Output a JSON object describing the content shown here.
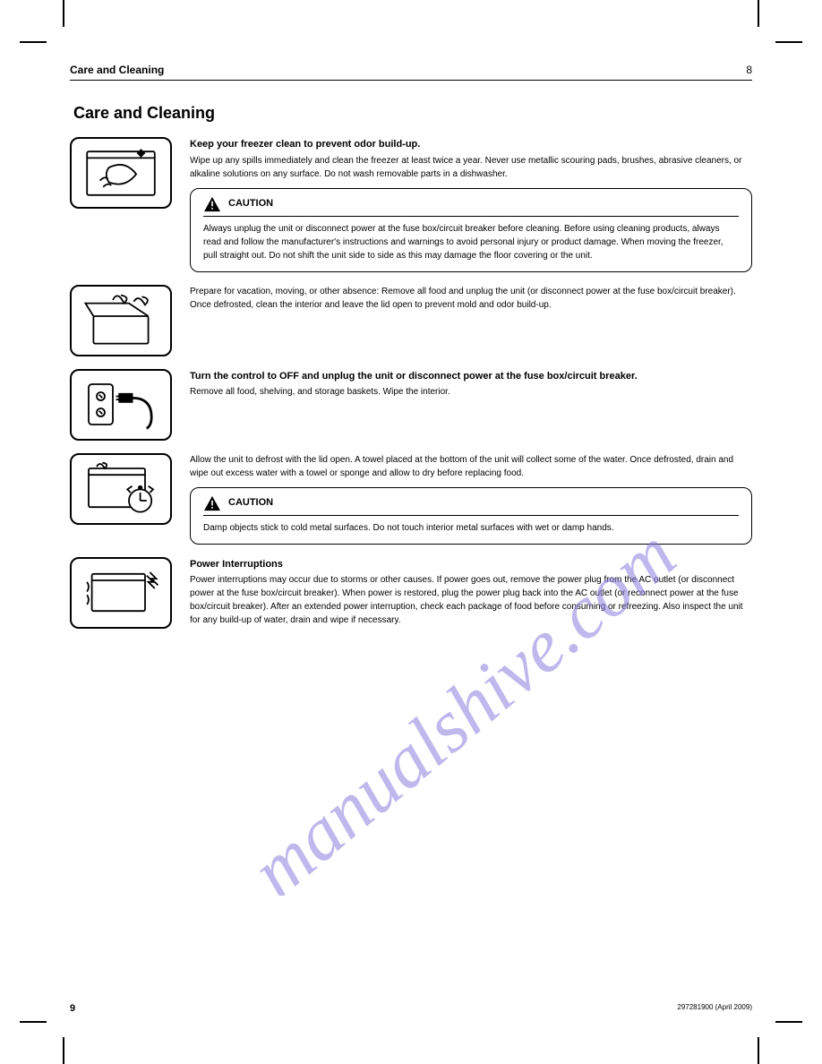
{
  "header": {
    "left": "Care and Cleaning",
    "right": "8"
  },
  "title": "Care and Cleaning",
  "sections": [
    {
      "icon": "clean-surface",
      "heading": "Keep your freezer clean to prevent odor build-up.",
      "body": "Wipe up any spills immediately and clean the freezer at least twice a year. Never use metallic scouring pads, brushes, abrasive cleaners, or alkaline solutions on any surface. Do not wash removable parts in a dishwasher.",
      "caution": {
        "title": "CAUTION",
        "body": "Always unplug the unit or disconnect power at the fuse box/circuit breaker before cleaning. Before using cleaning products, always read and follow the manufacturer's instructions and warnings to avoid personal injury or product damage. When moving the freezer, pull straight out. Do not shift the unit side to side as this may damage the floor covering or the unit."
      }
    },
    {
      "icon": "open-lid",
      "heading": "",
      "body": "Prepare for vacation, moving, or other absence: Remove all food and unplug the unit (or disconnect power at the fuse box/circuit breaker). Once defrosted, clean the interior and leave the lid open to prevent mold and odor build-up."
    },
    {
      "icon": "unplug",
      "heading": "Turn the control to OFF and unplug the unit or disconnect power at the fuse box/circuit breaker.",
      "body": "Remove all food, shelving, and storage baskets. Wipe the interior."
    },
    {
      "icon": "defrost-clock",
      "heading": "",
      "body": "Allow the unit to defrost with the lid open. A towel placed at the bottom of the unit will collect some of the water. Once defrosted, drain and wipe out excess water with a towel or sponge and allow to dry before replacing food.",
      "caution": {
        "title": "CAUTION",
        "body": "Damp objects stick to cold metal surfaces. Do not touch interior metal surfaces with wet or damp hands."
      }
    },
    {
      "icon": "power-surge",
      "heading": "Power Interruptions",
      "body": "Power interruptions may occur due to storms or other causes. If power goes out, remove the power plug from the AC outlet (or disconnect power at the fuse box/circuit breaker). When power is restored, plug the power plug back into the AC outlet (or reconnect power at the fuse box/circuit breaker). After an extended power interruption, check each package of food before consuming or refreezing. Also inspect the unit for any build-up of water, drain and wipe if necessary."
    }
  ],
  "footer": {
    "page": "9",
    "doc": "297281900 (April 2009)"
  }
}
